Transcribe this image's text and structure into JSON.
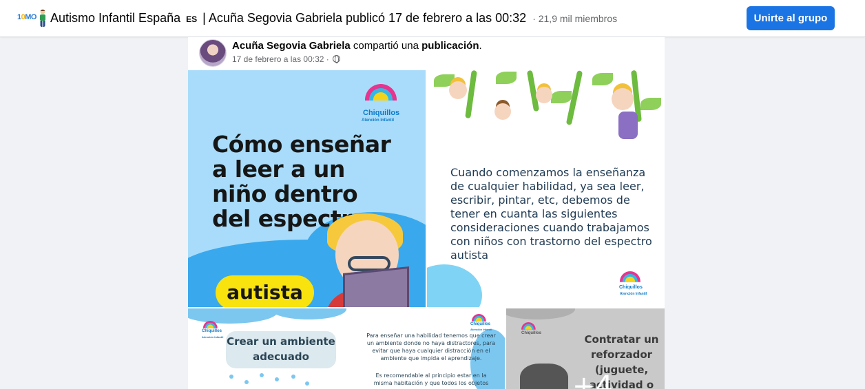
{
  "header": {
    "group_name": "Autismo Infantil España",
    "badge": "ES",
    "separator": "|",
    "post_title": "Acuña Segovia Gabriela publicó 17 de febrero a las 00:32",
    "members": "· 21,9 mil miembros",
    "join_label": "Unirte al grupo",
    "icon_text_prefix": "1",
    "icon_text_mid": "0",
    "icon_text_suffix": "MO"
  },
  "post": {
    "author": "Acuña Segovia Gabriela",
    "verb": "compartió una",
    "target": "publicación",
    "period": ".",
    "timestamp": "17 de febrero a las 00:32",
    "timestamp_sep": "·",
    "audience_icon": "globe-icon"
  },
  "photos": {
    "p1": {
      "logo_name": "Chiquillos",
      "logo_sub": "Atención Infantil",
      "headline": "Cómo enseñar a leer a un niño dentro del espectro",
      "pill": "autista"
    },
    "p2": {
      "body": "Cuando comenzamos la enseñanza de cualquier habilidad, ya sea leer, escribir, pintar, etc, debemos de tener en cuanta las siguientes consideraciones cuando trabajamos con niños con trastorno del espectro autista",
      "logo_name": "Chiquillos",
      "logo_sub": "Atención Infantil"
    },
    "p3": {
      "logo_name": "Chiquillos",
      "logo_sub": "Atención Infantil",
      "card": "Crear un ambiente adecuado",
      "para1": "Para enseñar una habilidad tenemos que crear un ambiente donde no haya distractores, para evitar que haya cualquier distracción en el ambiente que impida el aprendizaje.",
      "para2": "Es recomendable al principio estar en la misma habitación y que todos los objetos",
      "logo2_name": "Chiquillos",
      "logo2_sub": "Atención Infantil"
    },
    "p4": {
      "logo_name": "Chiquillos",
      "card": "Contratar un reforzador (juguete, actividad o",
      "more": "+4"
    }
  },
  "colors": {
    "primary": "#1b74e4",
    "secondary_text": "#65676b",
    "page_bg": "#f0f2f5"
  }
}
